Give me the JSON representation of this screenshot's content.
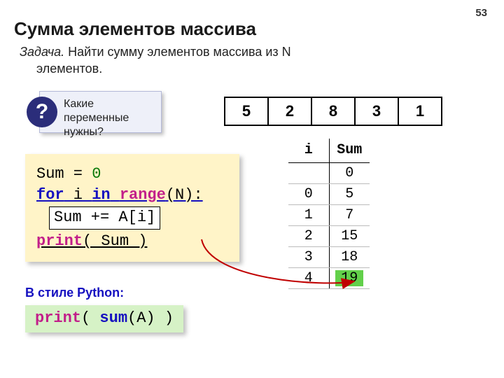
{
  "page_number": "53",
  "title": "Сумма элементов массива",
  "task": {
    "label": "Задача.",
    "line1_rest": " Найти сумму элементов массива из N",
    "line2": "элементов."
  },
  "question": {
    "mark": "?",
    "text_l1": "Какие переменные",
    "text_l2": "нужны?"
  },
  "array_values": [
    "5",
    "2",
    "8",
    "3",
    "1"
  ],
  "code": {
    "l1_a": "Sum = ",
    "l1_num": "0",
    "l2_for": "for",
    "l2_i": " i ",
    "l2_in": "in",
    "l2_sp": " ",
    "l2_range": "range",
    "l2_paren": "(N):",
    "l3_inner": "Sum += A[i]",
    "l4_print": "print",
    "l4_rest": "( Sum )"
  },
  "trace": {
    "head_i": "i",
    "head_sum": "Sum",
    "rows": [
      {
        "i": "",
        "sum": "0"
      },
      {
        "i": "0",
        "sum": "5"
      },
      {
        "i": "1",
        "sum": "7"
      },
      {
        "i": "2",
        "sum": "15"
      },
      {
        "i": "3",
        "sum": "18"
      },
      {
        "i": "4",
        "sum": "19"
      }
    ]
  },
  "python_style": {
    "label": "В стиле Python:",
    "print": "print",
    "open": "( ",
    "sum": "sum",
    "args": "(A) )"
  }
}
